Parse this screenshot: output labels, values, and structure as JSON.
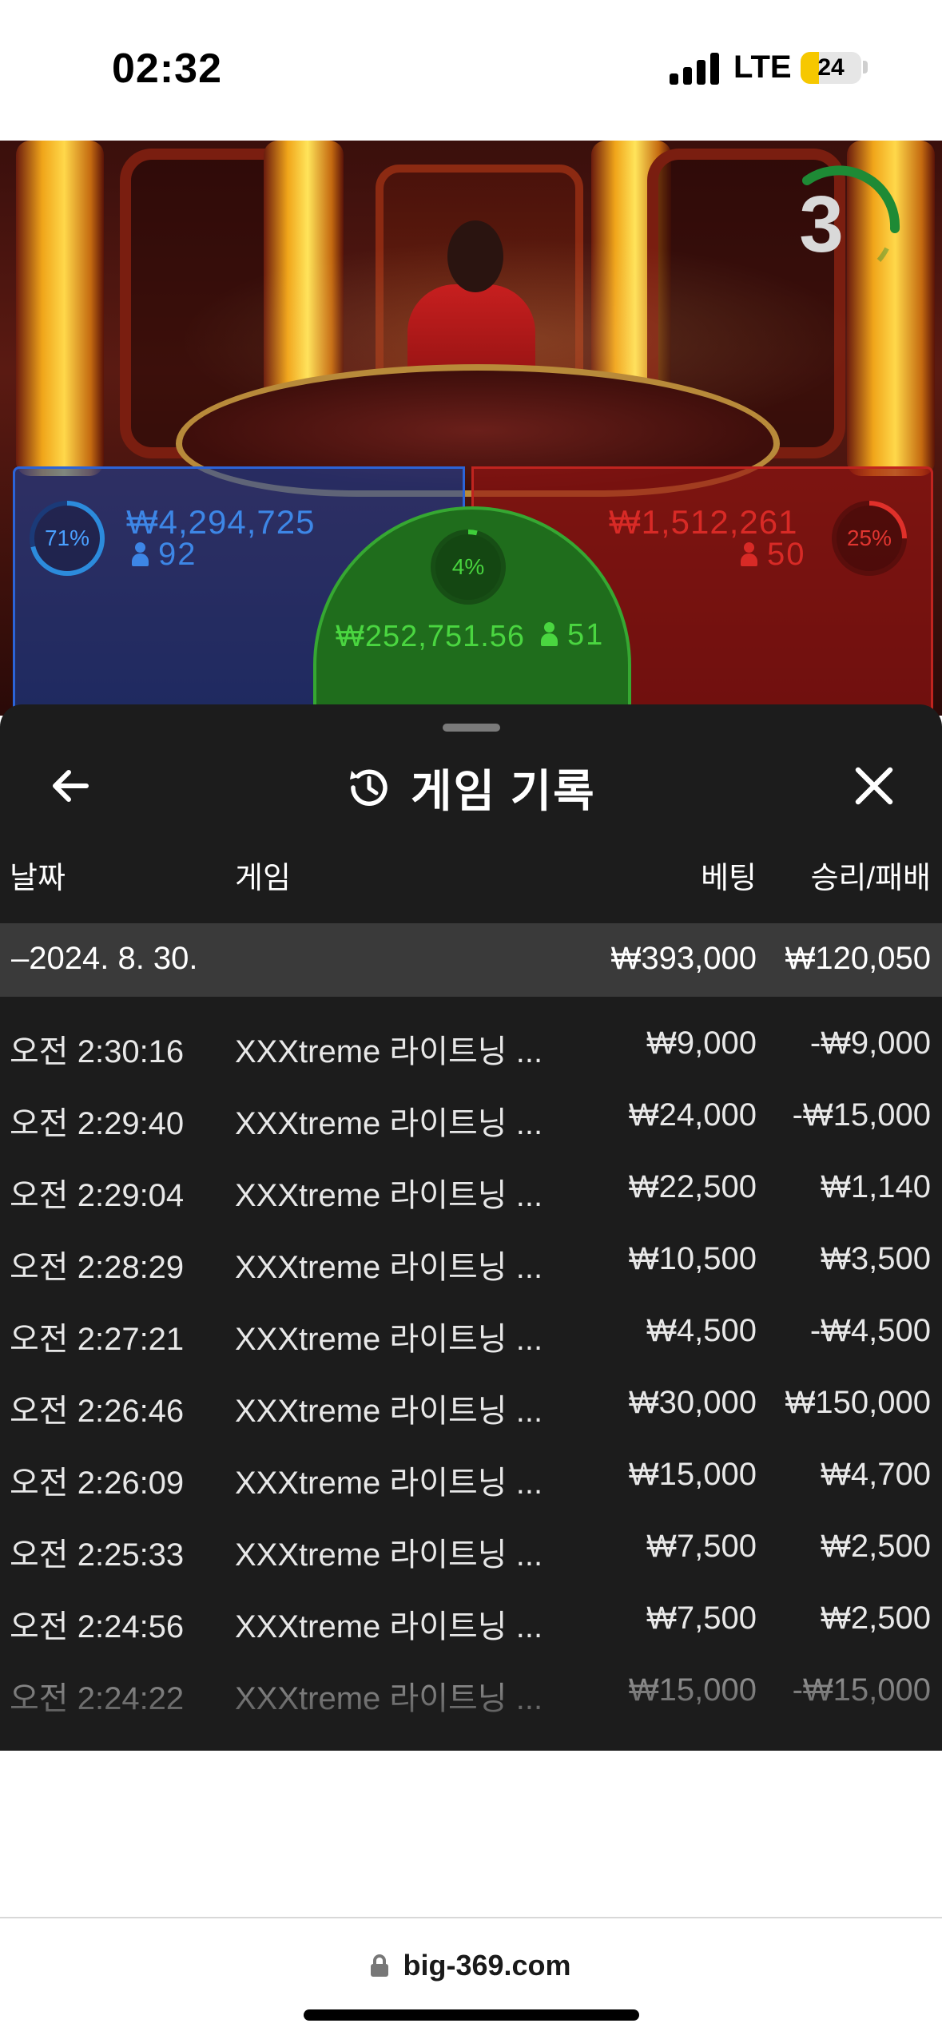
{
  "status_bar": {
    "time": "02:32",
    "network": "LTE",
    "battery": "24"
  },
  "game": {
    "countdown": "3",
    "player": {
      "percent": "71%",
      "amount": "₩4,294,725",
      "players": "92",
      "percent_value": 0.71
    },
    "tie": {
      "percent": "4%",
      "amount": "₩252,751.56",
      "players": "51",
      "percent_value": 0.04
    },
    "banker": {
      "percent": "25%",
      "amount": "₩1,512,261",
      "players": "50",
      "percent_value": 0.25
    },
    "colors": {
      "player": "#2c64d8",
      "tie": "#36a832",
      "banker": "#c0241f"
    }
  },
  "sheet": {
    "title": "게임 기록",
    "icons": {
      "back": "arrow-left-icon",
      "history": "history-icon",
      "close": "close-icon"
    },
    "columns": {
      "date": "날짜",
      "game": "게임",
      "bet": "베팅",
      "result": "승리/패배"
    },
    "day": {
      "label": "–2024. 8. 30.",
      "bet_total": "₩393,000",
      "result_total": "₩120,050"
    },
    "rows": [
      {
        "time": "오전 2:30:16",
        "game": "XXXtreme 라이트닝 ...",
        "bet": "₩9,000",
        "result": "-₩9,000"
      },
      {
        "time": "오전 2:29:40",
        "game": "XXXtreme 라이트닝 ...",
        "bet": "₩24,000",
        "result": "-₩15,000"
      },
      {
        "time": "오전 2:29:04",
        "game": "XXXtreme 라이트닝 ...",
        "bet": "₩22,500",
        "result": "₩1,140"
      },
      {
        "time": "오전 2:28:29",
        "game": "XXXtreme 라이트닝 ...",
        "bet": "₩10,500",
        "result": "₩3,500"
      },
      {
        "time": "오전 2:27:21",
        "game": "XXXtreme 라이트닝 ...",
        "bet": "₩4,500",
        "result": "-₩4,500"
      },
      {
        "time": "오전 2:26:46",
        "game": "XXXtreme 라이트닝 ...",
        "bet": "₩30,000",
        "result": "₩150,000"
      },
      {
        "time": "오전 2:26:09",
        "game": "XXXtreme 라이트닝 ...",
        "bet": "₩15,000",
        "result": "₩4,700"
      },
      {
        "time": "오전 2:25:33",
        "game": "XXXtreme 라이트닝 ...",
        "bet": "₩7,500",
        "result": "₩2,500"
      },
      {
        "time": "오전 2:24:56",
        "game": "XXXtreme 라이트닝 ...",
        "bet": "₩7,500",
        "result": "₩2,500"
      },
      {
        "time": "오전 2:24:22",
        "game": "XXXtreme 라이트닝 ...",
        "bet": "₩15,000",
        "result": "-₩15,000"
      }
    ]
  },
  "browser": {
    "url": "big-369.com"
  }
}
